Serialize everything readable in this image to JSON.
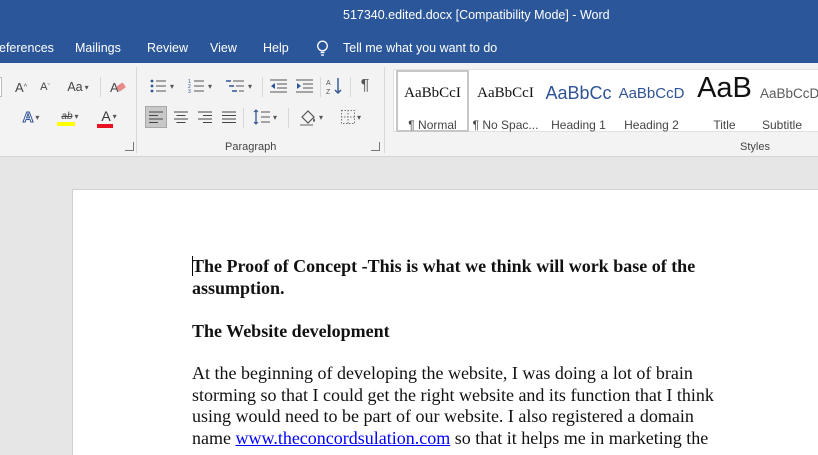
{
  "window": {
    "title": "517340.edited.docx [Compatibility Mode]  -  Word"
  },
  "tabs": [
    {
      "label": "eferences"
    },
    {
      "label": "Mailings"
    },
    {
      "label": "Review"
    },
    {
      "label": "View"
    },
    {
      "label": "Help"
    }
  ],
  "tell_me": {
    "label": "Tell me what you want to do"
  },
  "ribbon": {
    "font_group": {
      "grow_label": "A",
      "shrink_label": "A",
      "case_label": "Aa",
      "text_effects_label": "A",
      "highlight_label": "ab",
      "font_color_label": "A"
    },
    "paragraph_group": {
      "label": "Paragraph"
    },
    "styles_group": {
      "label": "Styles"
    },
    "styles": [
      {
        "sample": "AaBbCcI",
        "name": "¶ Normal"
      },
      {
        "sample": "AaBbCcI",
        "name": "¶ No Spac..."
      },
      {
        "sample": "AaBbCc",
        "name": "Heading 1"
      },
      {
        "sample": "AaBbCcD",
        "name": "Heading 2"
      },
      {
        "sample": "AaB",
        "name": "Title"
      },
      {
        "sample": "AaBbCcD",
        "name": "Subtitle"
      }
    ],
    "colors": {
      "highlight": "#ffff00",
      "font_color": "#e81123",
      "title_bar": "#2b579a",
      "heading": "#2f5496"
    }
  },
  "document": {
    "heading1_line1": "The Proof of Concept -This is what we think will work base of the",
    "heading1_line2": "assumption.",
    "heading2": "The Website development",
    "para_line1": "At the beginning of developing the website, I was doing a lot of brain",
    "para_line2": "storming so that I could get the right website and its function that I think",
    "para_line3": "using would need to be part of our website. I also registered a domain",
    "para_line4_a": "name ",
    "para_link": "www.theconcordsulation.com",
    "para_line4_b": " so that it helps me in marketing the"
  }
}
